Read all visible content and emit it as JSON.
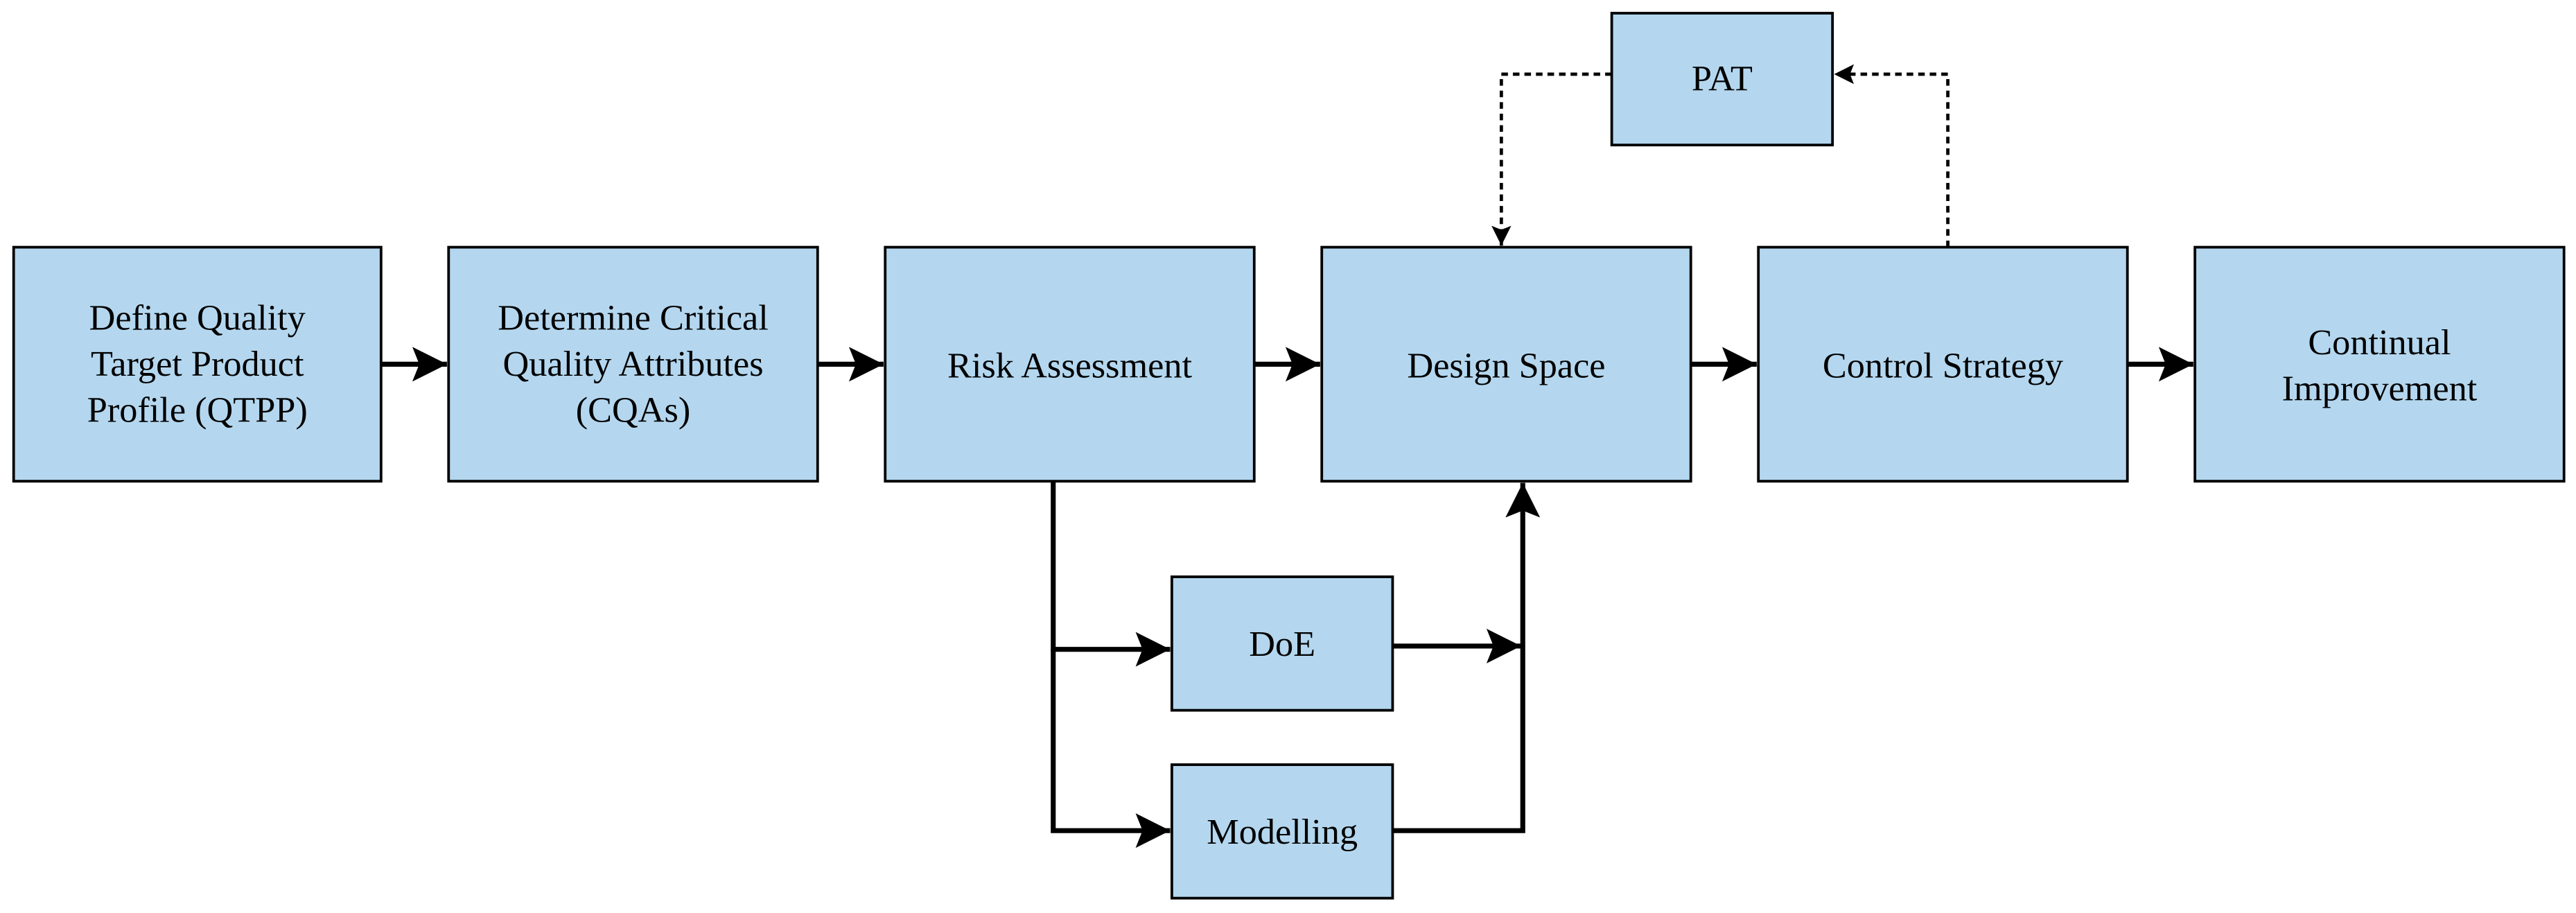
{
  "nodes": {
    "qtpp": {
      "lines": [
        "Define Quality",
        "Target Product",
        "Profile (QTPP)"
      ]
    },
    "cqa": {
      "lines": [
        "Determine Critical",
        "Quality Attributes",
        "(CQAs)"
      ]
    },
    "risk": {
      "lines": [
        "Risk Assessment"
      ]
    },
    "design": {
      "lines": [
        "Design Space"
      ]
    },
    "control": {
      "lines": [
        "Control Strategy"
      ]
    },
    "improve": {
      "lines": [
        "Continual",
        "Improvement"
      ]
    },
    "pat": {
      "lines": [
        "PAT"
      ]
    },
    "doe": {
      "lines": [
        "DoE"
      ]
    },
    "model": {
      "lines": [
        "Modelling"
      ]
    }
  },
  "colors": {
    "box_fill": "#b4d7ef",
    "stroke": "#000000"
  },
  "edges": [
    {
      "from": "qtpp",
      "to": "cqa",
      "style": "solid"
    },
    {
      "from": "cqa",
      "to": "risk",
      "style": "solid"
    },
    {
      "from": "risk",
      "to": "design",
      "style": "solid"
    },
    {
      "from": "design",
      "to": "control",
      "style": "solid"
    },
    {
      "from": "control",
      "to": "improve",
      "style": "solid"
    },
    {
      "from": "risk",
      "to": "doe",
      "style": "solid"
    },
    {
      "from": "risk",
      "to": "model",
      "style": "solid"
    },
    {
      "from": "doe",
      "to": "design",
      "style": "solid"
    },
    {
      "from": "model",
      "to": "design",
      "style": "solid"
    },
    {
      "from": "control",
      "to": "pat",
      "style": "dashed"
    },
    {
      "from": "pat",
      "to": "design",
      "style": "dashed"
    }
  ]
}
